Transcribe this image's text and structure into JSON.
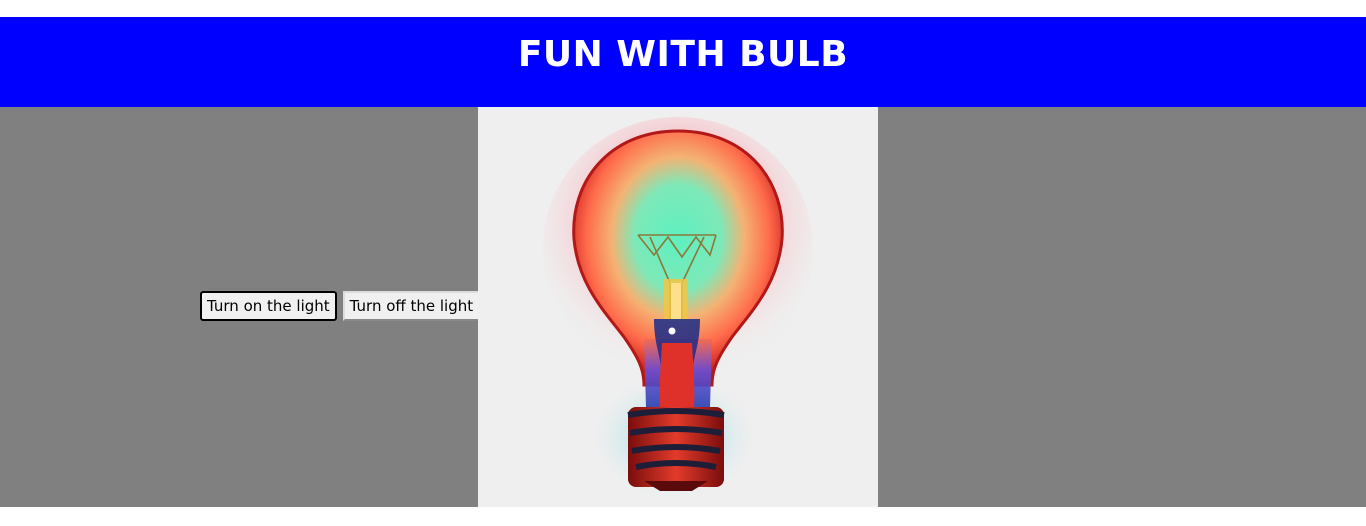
{
  "header": {
    "title": "FUN WITH BULB",
    "background_color": "#0000ff",
    "text_color": "#ffffff"
  },
  "main": {
    "background_color": "#808080"
  },
  "controls": {
    "on_label": "Turn on the light",
    "off_label": "Turn off the light"
  },
  "bulb": {
    "state": "on",
    "icon": "lightbulb-icon",
    "glow_colors": [
      "#ff3b3b",
      "#ff9a5a",
      "#5ef0c0",
      "#3a7bd5"
    ]
  }
}
